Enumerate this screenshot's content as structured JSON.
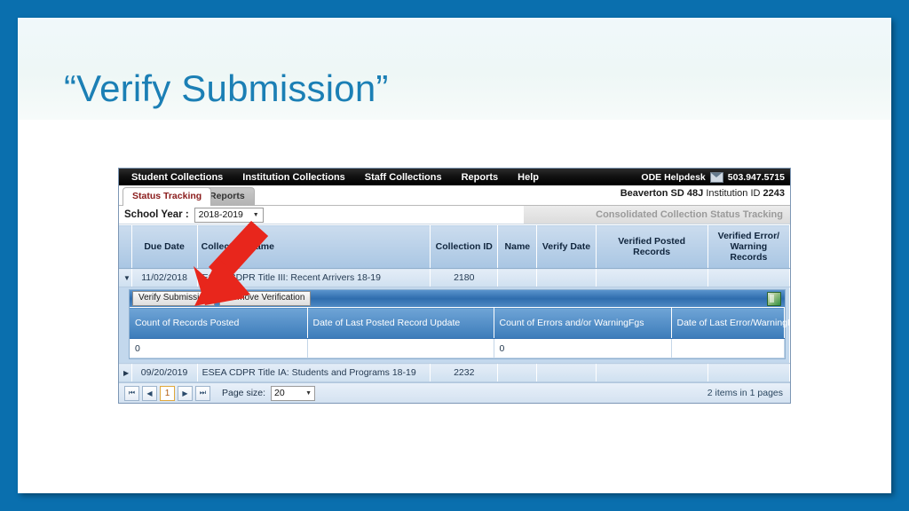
{
  "slide": {
    "title": "“Verify Submission”",
    "accent_color": "#1b7fb5",
    "border_color": "#0a6fae"
  },
  "app": {
    "navbar": {
      "items": [
        "Student Collections",
        "Institution Collections",
        "Staff Collections",
        "Reports",
        "Help"
      ],
      "helpdesk_label": "ODE Helpdesk",
      "helpdesk_icon": "mail-icon",
      "phone": "503.947.5715"
    },
    "tabs": [
      {
        "label": "Status Tracking",
        "active": true
      },
      {
        "label": "Reports",
        "active": false
      }
    ],
    "org": {
      "name": "Beaverton SD 48J",
      "id_label": "Institution ID",
      "id_value": "2243"
    },
    "filter": {
      "school_year_label": "School Year :",
      "school_year_value": "2018-2019",
      "banner": "Consolidated Collection Status Tracking"
    },
    "grid": {
      "columns": [
        "Due Date",
        "Collection Name",
        "Collection ID",
        "Name",
        "Verify Date",
        "Verified Posted Records",
        "Verified Error/ Warning Records"
      ],
      "rows": [
        {
          "expander": "▼",
          "due_date": "11/02/2018",
          "collection_name": "ESEA CDPR Title III: Recent Arrivers 18-19",
          "collection_id": "2180",
          "name": "",
          "verify_date": "",
          "verified_posted_records": "",
          "verified_error_warning_records": "",
          "expanded": true
        },
        {
          "expander": "▶",
          "due_date": "09/20/2019",
          "collection_name": "ESEA CDPR Title IA: Students and Programs 18-19",
          "collection_id": "2232",
          "name": "",
          "verify_date": "",
          "verified_posted_records": "",
          "verified_error_warning_records": "",
          "expanded": false
        }
      ]
    },
    "detail": {
      "verify_button": "Verify Submission",
      "remove_button": "Remove Verification",
      "export_icon": "excel-export-icon",
      "columns": [
        "Count of Records Posted",
        "Date of Last Posted Record Update",
        "Count of Errors and/or WarningFgs",
        "Date of Last Error/WarningFg Update"
      ],
      "row": {
        "count_records_posted": "0",
        "date_last_posted_update": "",
        "count_errors_warnings": "0",
        "date_last_error_update": ""
      }
    },
    "pager": {
      "first": "⏮",
      "prev": "◀",
      "page": "1",
      "next": "▶",
      "last": "⏭",
      "page_size_label": "Page size:",
      "page_size_value": "20",
      "items_info": "2 items in 1 pages"
    }
  },
  "annotation": {
    "arrow_color": "#e8261c",
    "arrow_target": "verify-submission-button"
  }
}
